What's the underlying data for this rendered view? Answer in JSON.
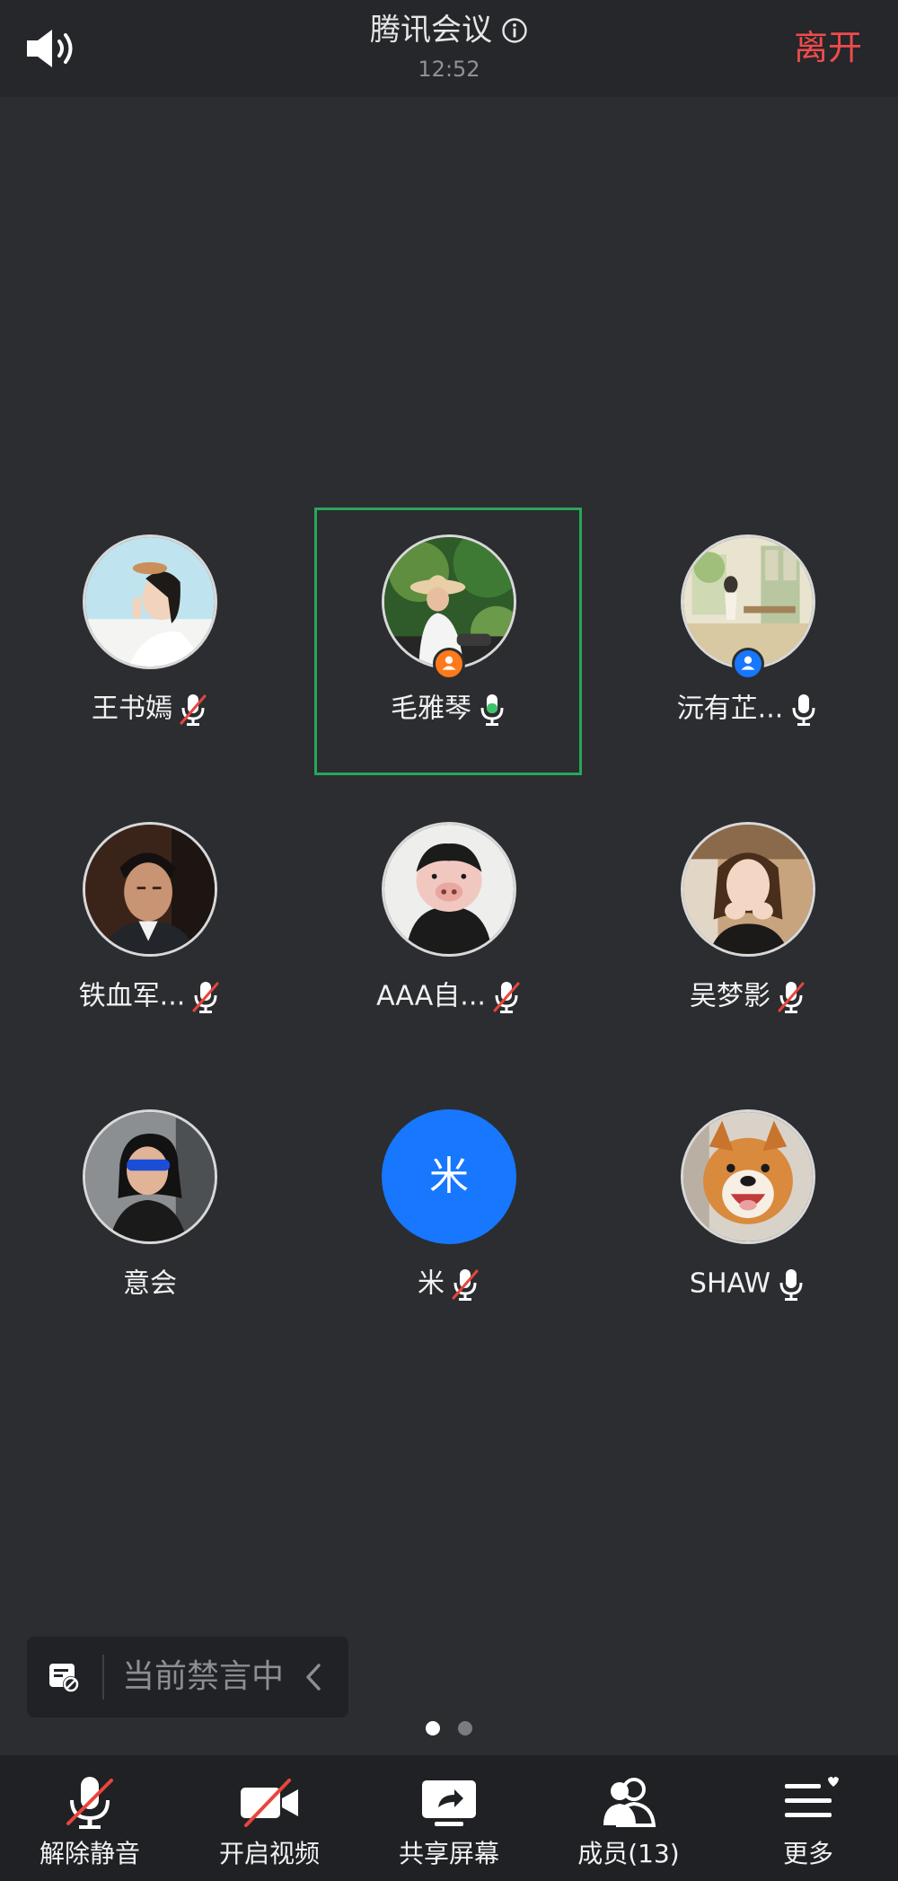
{
  "header": {
    "title": "腾讯会议",
    "time": "12:52",
    "leave_label": "离开",
    "speaker_icon": "speaker-icon",
    "info_icon": "info-icon"
  },
  "participants": [
    {
      "name": "王书嫣",
      "mic": "muted",
      "role": "",
      "active": false
    },
    {
      "name": "毛雅琴",
      "mic": "on-speaking",
      "role": "host",
      "active": true
    },
    {
      "name": "沅有芷...",
      "mic": "on",
      "role": "co-host",
      "active": false
    },
    {
      "name": "铁血军...",
      "mic": "muted",
      "role": "",
      "active": false
    },
    {
      "name": "AAA自...",
      "mic": "muted",
      "role": "",
      "active": false
    },
    {
      "name": "吴梦影",
      "mic": "muted",
      "role": "",
      "active": false
    },
    {
      "name": "意会",
      "mic": "none",
      "role": "",
      "active": false
    },
    {
      "name": "米",
      "mic": "muted",
      "role": "",
      "active": false,
      "avatar_letter": "米"
    },
    {
      "name": "SHAW",
      "mic": "on",
      "role": "",
      "active": false
    }
  ],
  "mute_banner": {
    "text": "当前禁言中"
  },
  "pager": {
    "pages": 2,
    "current": 1
  },
  "toolbar": {
    "unmute_label": "解除静音",
    "video_label": "开启视频",
    "share_label": "共享屏幕",
    "members_label": "成员(13)",
    "more_label": "更多"
  },
  "colors": {
    "background": "#2b2d31",
    "leave": "#f04b4b",
    "active_border": "#29a65b",
    "speaking_mic": "#3ec26a",
    "muted_slash": "#e8453c",
    "host_badge": "#ff7a1a",
    "cohost_badge": "#1777ff",
    "letter_avatar": "#1777ff"
  }
}
